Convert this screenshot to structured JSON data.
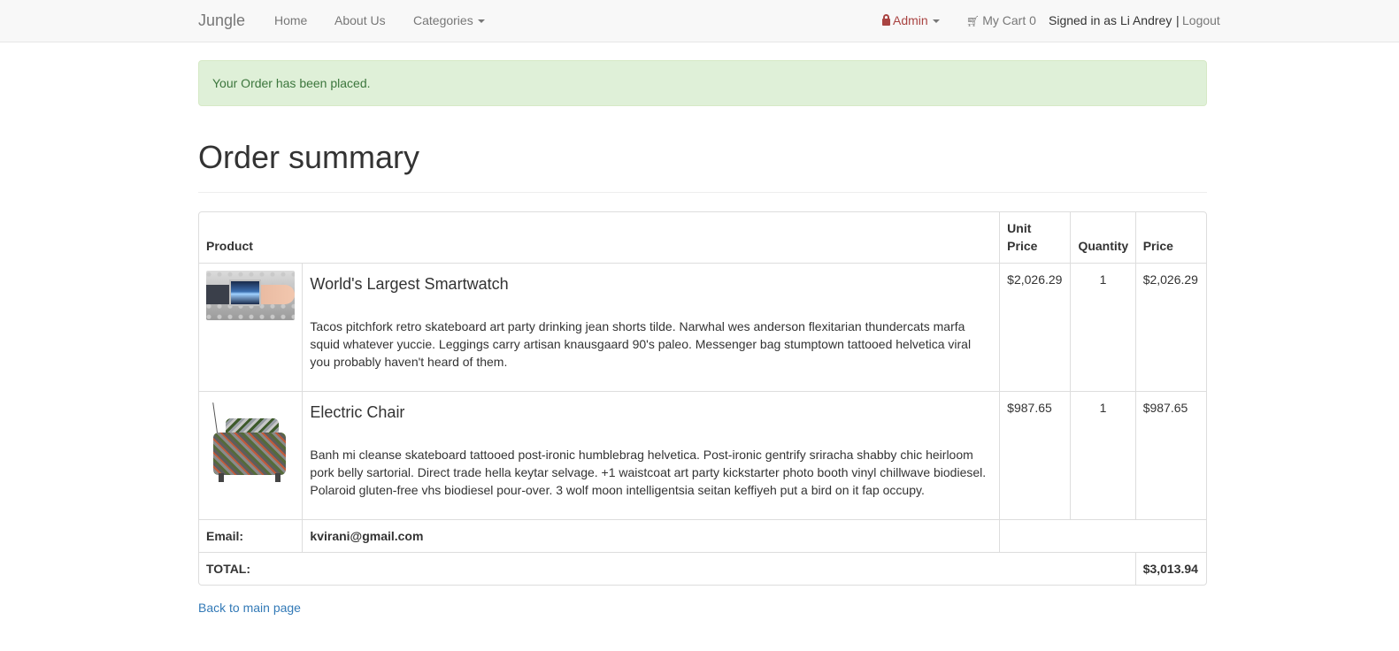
{
  "navbar": {
    "brand": "Jungle",
    "links": {
      "home": "Home",
      "about": "About Us",
      "categories": "Categories"
    },
    "admin": "Admin",
    "cart": "My Cart 0",
    "signed_in": "Signed in as Li Andrey",
    "separator": "|",
    "logout": "Logout",
    "icons": {
      "lock": "lock-icon",
      "cart": "shopping-cart-icon",
      "dropdown": "caret-down-icon"
    }
  },
  "alert": {
    "message": "Your Order has been placed.",
    "color": "#3c763d",
    "background": "#dff0d8"
  },
  "page": {
    "title": "Order summary"
  },
  "table": {
    "headers": {
      "product": "Product",
      "unit_price_1": "Unit",
      "unit_price_2": "Price",
      "quantity": "Quantity",
      "price": "Price"
    },
    "items": [
      {
        "name": "World's Largest Smartwatch",
        "description": "Tacos pitchfork retro skateboard art party drinking jean shorts tilde. Narwhal wes anderson flexitarian thundercats marfa squid whatever yuccie. Leggings carry artisan knausgaard 90's paleo. Messenger bag stumptown tattooed helvetica viral you probably haven't heard of them.",
        "unit_price": "$2,026.29",
        "quantity": "1",
        "price": "$2,026.29"
      },
      {
        "name": "Electric Chair",
        "description": "Banh mi cleanse skateboard tattooed post-ironic humblebrag helvetica. Post-ironic gentrify sriracha shabby chic heirloom pork belly sartorial. Direct trade hella keytar selvage. +1 waistcoat art party kickstarter photo booth vinyl chillwave biodiesel. Polaroid gluten-free vhs biodiesel pour-over. 3 wolf moon intelligentsia seitan keffiyeh put a bird on it fap occupy.",
        "unit_price": "$987.65",
        "quantity": "1",
        "price": "$987.65"
      }
    ],
    "email_label": "Email:",
    "email_value": "kvirani@gmail.com",
    "total_label": "TOTAL:",
    "total_value": "$3,013.94"
  },
  "back_link": "Back to main page",
  "colors": {
    "link": "#337ab7",
    "admin": "#a94442",
    "navbar_bg": "#f8f8f8"
  }
}
